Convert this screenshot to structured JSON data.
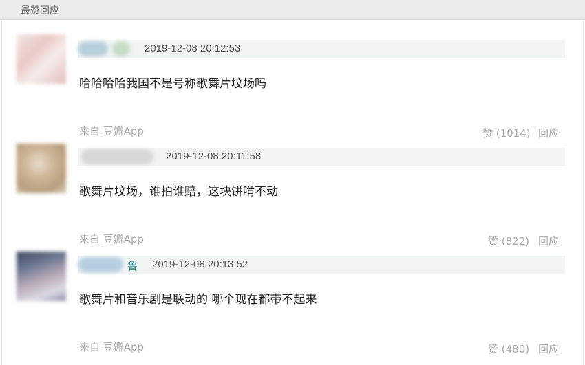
{
  "section": {
    "title": "最赞回应"
  },
  "comments": [
    {
      "username": "",
      "timestamp": "2019-12-08 20:12:53",
      "text": "哈哈哈哈我国不是号称歌舞片坟场吗",
      "source": "来自 豆瓣App",
      "likes": "赞 (1014)",
      "reply": "回应"
    },
    {
      "username": "",
      "timestamp": "2019-12-08 20:11:58",
      "text": "歌舞片坟场，谁拍谁赔，这块饼啃不动",
      "source": "来自 豆瓣App",
      "likes": "赞 (822)",
      "reply": "回应"
    },
    {
      "username": "鲁",
      "timestamp": "2019-12-08 20:13:52",
      "text": "歌舞片和音乐剧是联动的 哪个现在都带不起来",
      "source": "来自 豆瓣App",
      "likes": "赞 (480)",
      "reply": "回应"
    }
  ]
}
